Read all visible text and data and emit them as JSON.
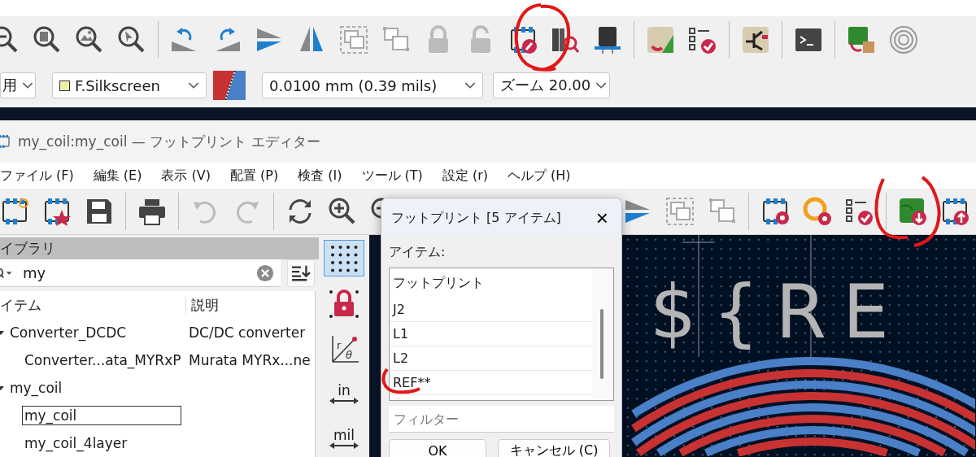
{
  "pcb_toolbar": {
    "combos": [
      {
        "value": "用"
      },
      {
        "value": "F.Silkscreen",
        "kind": "layer"
      },
      {
        "value": "0.0100 mm (0.39 mils)"
      },
      {
        "value": "ズーム 20.00"
      }
    ]
  },
  "footprint_editor": {
    "title": "my_coil:my_coil — フットプリント エディター",
    "menu": [
      "ファイル (F)",
      "編集 (E)",
      "表示 (V)",
      "配置 (P)",
      "検査 (I)",
      "ツール (T)",
      "設定 (r)",
      "ヘルプ (H)"
    ],
    "library": {
      "header": "イブラリ",
      "search": {
        "value": "my"
      },
      "columns": [
        "イテム",
        "説明"
      ],
      "tree": [
        {
          "name": "Converter_DCDC",
          "description": "DC/DC converter",
          "expanded": true,
          "selected": false,
          "children": [
            {
              "name": "Converter...ata_MYRxP",
              "description": "Murata MYRx...ne",
              "selected": false
            }
          ]
        },
        {
          "name": "my_coil",
          "expanded": true,
          "selected": false,
          "children": [
            {
              "name": "my_coil",
              "selected": true
            },
            {
              "name": "my_coil_4layer",
              "selected": false
            }
          ]
        }
      ]
    },
    "side_toolbar": [
      {
        "kind": "grid",
        "selected": true
      },
      {
        "kind": "grid_lock",
        "selected": false
      },
      {
        "kind": "polar",
        "selected": false,
        "labels": [
          "r",
          "θ"
        ]
      },
      {
        "kind": "units",
        "label": "in",
        "selected": false
      },
      {
        "kind": "units",
        "label": "mil",
        "selected": false
      }
    ],
    "canvas": {
      "silkscreen_text": "${RE"
    }
  },
  "dialog": {
    "title": "フットプリント [5 アイテム]",
    "close": "×",
    "list_label": "アイテム:",
    "items": [
      {
        "label": "フットプリント",
        "selected": false
      },
      {
        "label": "J2",
        "selected": false
      },
      {
        "label": "L1",
        "selected": false
      },
      {
        "label": "L2",
        "selected": false
      },
      {
        "label": "REF**",
        "selected": false
      }
    ],
    "filter": {
      "placeholder": "フィルター"
    },
    "buttons": [
      "OK",
      "キャンセル (C)"
    ]
  }
}
